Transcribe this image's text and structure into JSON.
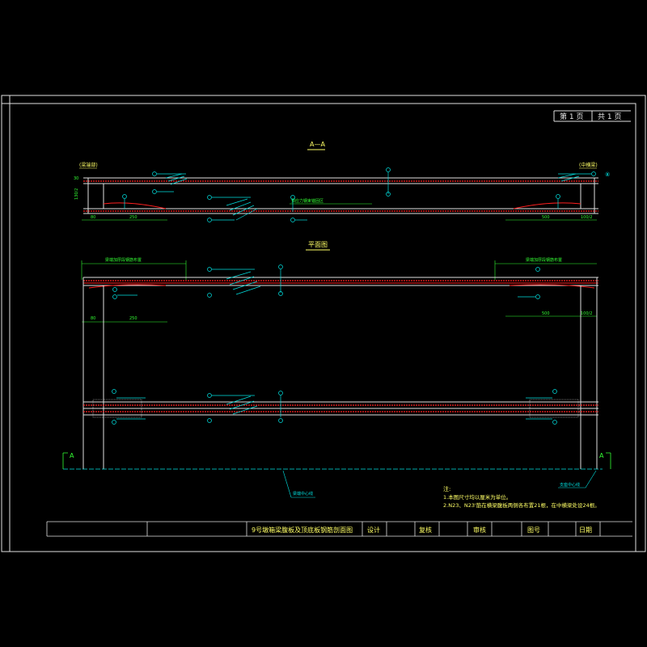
{
  "sheet": {
    "page_label": "第 1 页",
    "total_label": "共 1 页"
  },
  "section_view": {
    "title": "A—A",
    "left_tag": "(梁端部)",
    "right_tag": "(中横梁)",
    "dim_left_a": "80",
    "dim_left_b": "250",
    "dim_right_a": "500",
    "dim_right_b": "100/2",
    "dim_height": "130/2",
    "dim_top": "30",
    "callout_label": "预应力钢束锚固区",
    "top_marker": "⑧"
  },
  "plan_view": {
    "title": "平面图",
    "dim_left_a": "80",
    "dim_left_b": "250",
    "dim_right_a": "500",
    "dim_right_b": "100/2",
    "left_span_label": "梁端加厚段钢筋布置",
    "right_span_label": "梁端加厚段钢筋布置"
  },
  "markers": {
    "section_left": "A",
    "section_right": "A",
    "bottom_left_label": "梁端中心线",
    "bottom_right_label": "支座中心线"
  },
  "notes": {
    "heading": "注:",
    "line1": "1.本图尺寸均以厘米为单位。",
    "line2": "2.N23、N23'筋在横梁腹板两侧各布置21根，在中横梁处设24根。"
  },
  "title_block": {
    "drawing_title": "9号墩箱梁腹板及顶底板钢筋剖面图",
    "design": "设计",
    "review": "复核",
    "approve": "审核",
    "drawing_no": "图号",
    "date": "日期"
  },
  "colors": {
    "frame": "#ffffff",
    "line_cyan": "#00e0e0",
    "line_red": "#ff2020",
    "text_yellow": "#ffff66",
    "dim_green": "#33ff33"
  }
}
